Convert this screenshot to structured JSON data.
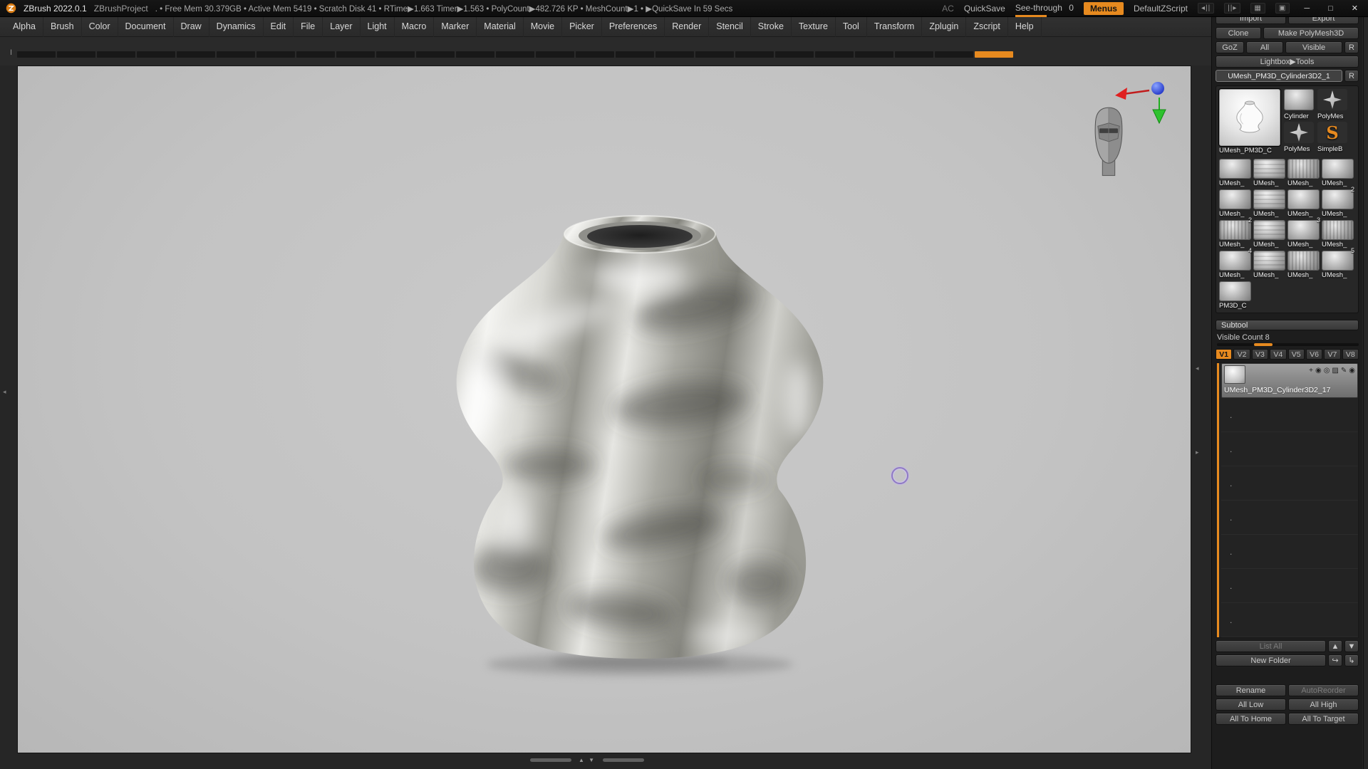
{
  "titlebar": {
    "app_title": "ZBrush 2022.0.1",
    "project": "ZBrushProject",
    "status": ". • Free Mem 30.379GB • Active Mem 5419 • Scratch Disk 41 • RTime▶1.663 Timer▶1.563 • PolyCount▶482.726 KP • MeshCount▶1 • ▶QuickSave In 59 Secs",
    "ac": "AC",
    "quicksave": "QuickSave",
    "see_through": "See-through",
    "see_through_value": "0",
    "menus": "Menus",
    "default_zscript": "DefaultZScript",
    "icon_cluster": [
      "◂||",
      "||▸",
      "▦",
      "▣"
    ],
    "minimize": "─",
    "maximize": "□",
    "close": "✕"
  },
  "menubar": {
    "items": [
      "Alpha",
      "Brush",
      "Color",
      "Document",
      "Draw",
      "Dynamics",
      "Edit",
      "File",
      "Layer",
      "Light",
      "Macro",
      "Marker",
      "Material",
      "Movie",
      "Picker",
      "Preferences",
      "Render",
      "Stencil",
      "Stroke",
      "Texture",
      "Tool",
      "Transform",
      "Zplugin",
      "Zscript",
      "Help"
    ]
  },
  "tabstrip": {
    "segment_count": 25,
    "active_index": 24,
    "marker": "I"
  },
  "viewport": {
    "accent_orange": "#e78a1f",
    "cursor_color": "#8f79c6",
    "axis_colors": {
      "x": "#d42222",
      "y": "#2ec22e",
      "z": "#2438cc"
    },
    "scroll_up": "▲",
    "scroll_down": "▼",
    "edge_left": "◂",
    "edge_right": "▸"
  },
  "tool_panel": {
    "import": "Import",
    "export": "Export",
    "clone": "Clone",
    "make_polymesh3d": "Make PolyMesh3D",
    "goz": "GoZ",
    "goz_all": "All",
    "goz_visible": "Visible",
    "goz_r": "R",
    "lightbox_tools": "Lightbox▶Tools",
    "current_tool": "UMesh_PM3D_Cylinder3D2_1",
    "current_tool_r": "R",
    "big_thumb_label": "UMesh_PM3D_C",
    "side_thumbs": [
      {
        "label": "Cylinder",
        "kind": "cylinder"
      },
      {
        "label": "PolyMes",
        "kind": "star"
      },
      {
        "label": "PolyMes",
        "kind": "star"
      },
      {
        "label": "SimpleB",
        "kind": "sbrush",
        "glyph": "S"
      }
    ],
    "grid": [
      {
        "label": "UMesh_"
      },
      {
        "label": "UMesh_"
      },
      {
        "label": "UMesh_"
      },
      {
        "label": "UMesh_"
      },
      {
        "label": "UMesh_"
      },
      {
        "label": "UMesh_"
      },
      {
        "label": "UMesh_"
      },
      {
        "label": "UMesh_",
        "badge": "2"
      },
      {
        "label": "UMesh_",
        "badge": "2"
      },
      {
        "label": "UMesh_"
      },
      {
        "label": "UMesh_",
        "badge": "3"
      },
      {
        "label": "UMesh_"
      },
      {
        "label": "UMesh_",
        "badge": "4"
      },
      {
        "label": "UMesh_"
      },
      {
        "label": "UMesh_"
      },
      {
        "label": "UMesh_",
        "badge": "5"
      },
      {
        "label": "PM3D_C"
      }
    ]
  },
  "subtool": {
    "title": "Subtool",
    "visible_count": "Visible Count 8",
    "tabs": [
      "V1",
      "V2",
      "V3",
      "V4",
      "V5",
      "V6",
      "V7",
      "V8"
    ],
    "active_tab": "V1",
    "item_label": "UMesh_PM3D_Cylinder3D2_17",
    "item_icons": [
      {
        "name": "transform-icon",
        "glyph": "+"
      },
      {
        "name": "polypaint-eye-icon",
        "glyph": "◉"
      },
      {
        "name": "visibility-eye-icon",
        "glyph": "◎"
      },
      {
        "name": "uv-shade-icon",
        "glyph": "▨"
      },
      {
        "name": "sculpt-pen-icon",
        "glyph": "✎"
      },
      {
        "name": "eye-icon",
        "glyph": "◉"
      }
    ],
    "empty_rows": 7,
    "empty_marker": ".",
    "list_all": "List All",
    "up_arrow": "▲",
    "down_arrow": "▼",
    "new_folder": "New Folder",
    "folder_arrow_1": "↪",
    "folder_arrow_2": "↳",
    "rename": "Rename",
    "autoreorder": "AutoReorder",
    "all_low": "All Low",
    "all_high": "All High",
    "all_to_home": "All To Home",
    "all_to_target": "All To Target"
  }
}
